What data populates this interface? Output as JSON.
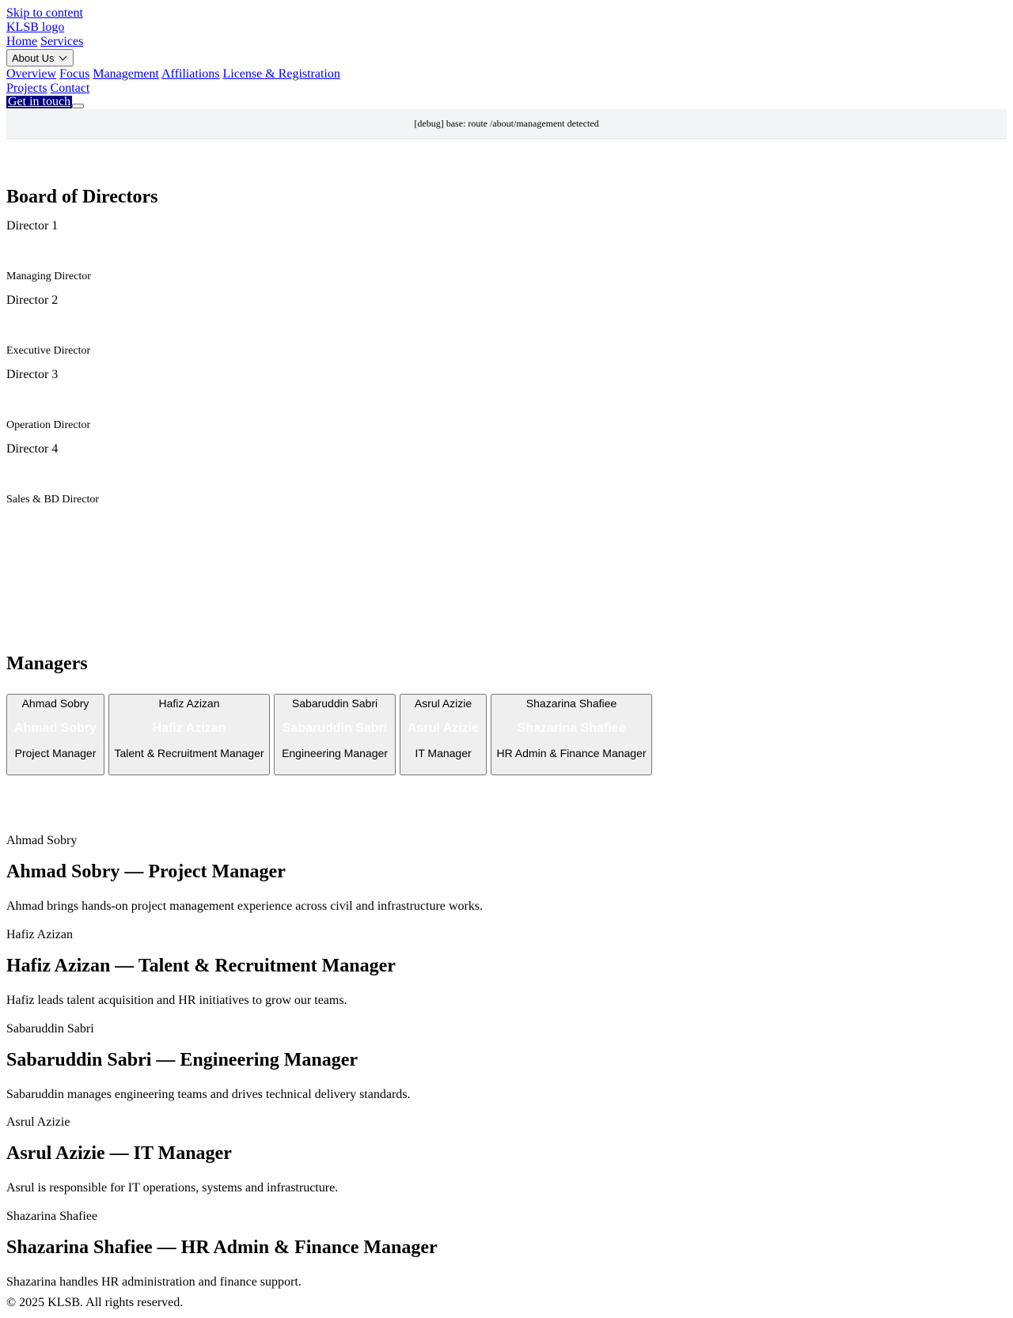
{
  "header": {
    "skip_link": "Skip to content",
    "logo_alt": "KLSB logo",
    "nav": {
      "home": "Home",
      "services": "Services",
      "about": "About Us",
      "projects": "Projects",
      "contact": "Contact"
    },
    "about_sub": {
      "overview": "Overview",
      "focus": "Focus",
      "management": "Management",
      "affiliations": "Affiliations",
      "license": "License & Registration"
    },
    "cta": "Get in touch"
  },
  "debug": "[debug] base: route /about/management detected",
  "board": {
    "title": "Board of Directors",
    "directors": [
      {
        "alt": "Director 1",
        "role": "Managing Director"
      },
      {
        "alt": "Director 2",
        "role": "Executive Director"
      },
      {
        "alt": "Director 3",
        "role": "Operation Director"
      },
      {
        "alt": "Director 4",
        "role": "Sales & BD Director"
      }
    ]
  },
  "managers": {
    "title": "Managers",
    "cards": [
      {
        "alt": "Ahmad Sobry",
        "name": "Ahmad Sobry",
        "role": "Project Manager"
      },
      {
        "alt": "Hafiz Azizan",
        "name": "Hafiz Azizan",
        "role": "Talent & Recruitment Manager"
      },
      {
        "alt": "Sabaruddin Sabri",
        "name": "Sabaruddin Sabri",
        "role": "Engineering Manager"
      },
      {
        "alt": "Asrul Azizie",
        "name": "Asrul Azizie",
        "role": "IT Manager"
      },
      {
        "alt": "Shazarina Shafiee",
        "name": "Shazarina Shafiee",
        "role": "HR Admin & Finance Manager"
      }
    ]
  },
  "bios": [
    {
      "alt": "Ahmad Sobry",
      "heading": "Ahmad Sobry — Project Manager",
      "text": "Ahmad brings hands-on project management experience across civil and infrastructure works."
    },
    {
      "alt": "Hafiz Azizan",
      "heading": "Hafiz Azizan — Talent & Recruitment Manager",
      "text": "Hafiz leads talent acquisition and HR initiatives to grow our teams."
    },
    {
      "alt": "Sabaruddin Sabri",
      "heading": "Sabaruddin Sabri — Engineering Manager",
      "text": "Sabaruddin manages engineering teams and drives technical delivery standards."
    },
    {
      "alt": "Asrul Azizie",
      "heading": "Asrul Azizie — IT Manager",
      "text": "Asrul is responsible for IT operations, systems and infrastructure."
    },
    {
      "alt": "Shazarina Shafiee",
      "heading": "Shazarina Shafiee — HR Admin & Finance Manager",
      "text": "Shazarina handles HR administration and finance support."
    }
  ],
  "footer": "© 2025 KLSB. All rights reserved."
}
